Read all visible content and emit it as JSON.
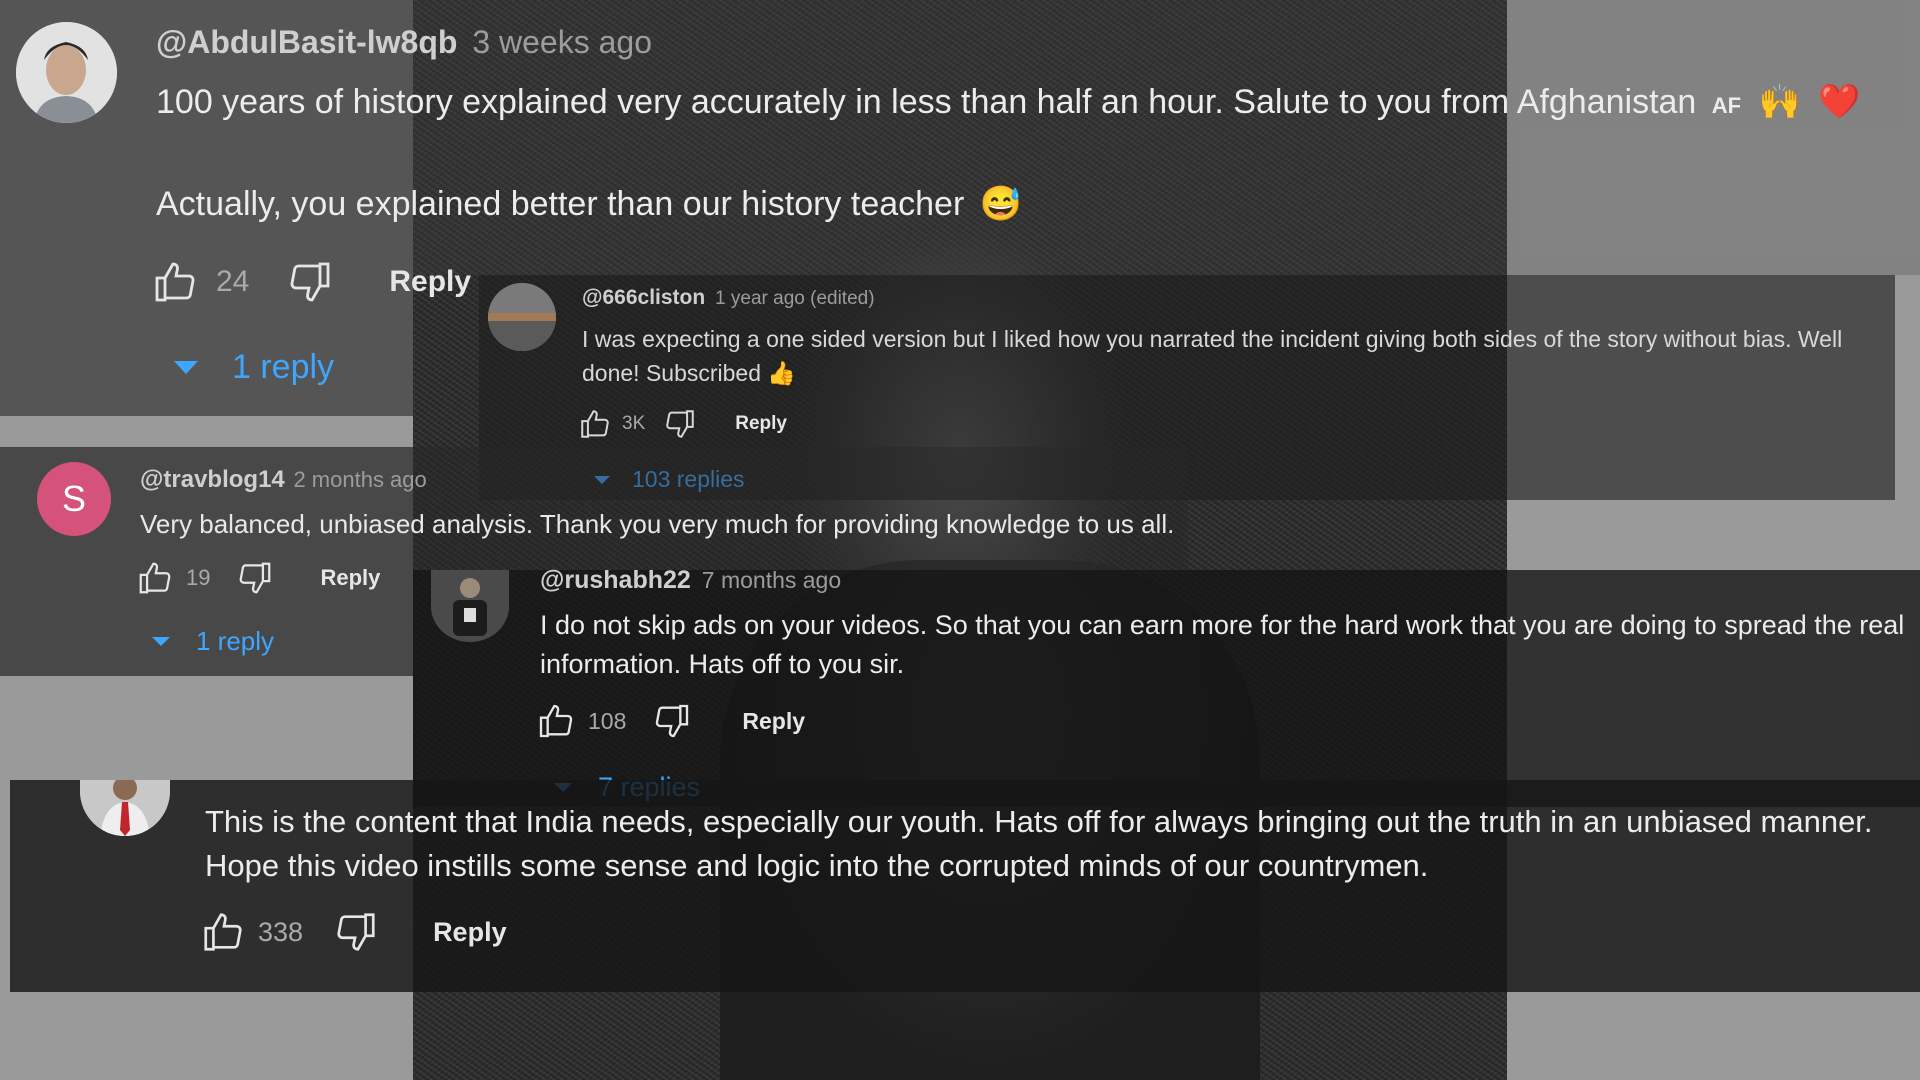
{
  "comments": [
    {
      "handle": "@AbdulBasit-lw8qb",
      "time": "3 weeks ago",
      "text_line1": "100 years of history explained very accurately in less than half an hour. Salute to you from Afghanistan",
      "flag": "AF",
      "emoji1": "🙌",
      "emoji2": "❤️",
      "text_line2": "Actually, you explained better than our history teacher",
      "emoji3": "😅",
      "likes": "24",
      "reply_label": "Reply",
      "replies_label": "1 reply"
    },
    {
      "handle": "@666cliston",
      "time": "1 year ago (edited)",
      "text": "I was expecting a one sided version but I liked how you narrated the incident giving both sides of the story without bias. Well done! Subscribed",
      "emoji": "👍",
      "likes": "3K",
      "reply_label": "Reply",
      "replies_label": "103 replies"
    },
    {
      "handle": "@travblog14",
      "time": "2 months ago",
      "avatar_letter": "S",
      "text": "Very balanced, unbiased analysis. Thank you very much for providing knowledge to us all.",
      "likes": "19",
      "reply_label": "Reply",
      "replies_label": "1 reply"
    },
    {
      "handle": "@rushabh22",
      "time": "7 months ago",
      "text": "I do not skip ads on your videos. So that you can earn more for the hard work that you are doing to spread the real information. Hats off to you sir.",
      "likes": "108",
      "reply_label": "Reply",
      "replies_label": "7 replies"
    },
    {
      "text": "This is the content that India needs, especially our youth. Hats off for always bringing out the truth in an unbiased manner. Hope this video instills some sense and logic into the corrupted minds of our countrymen.",
      "likes": "338",
      "reply_label": "Reply"
    }
  ],
  "colors": {
    "link_blue": "#3ea6ff",
    "avatar_pink": "#d5527a"
  },
  "icons": [
    "like-icon",
    "dislike-icon",
    "expand-triangle-icon",
    "avatar"
  ]
}
